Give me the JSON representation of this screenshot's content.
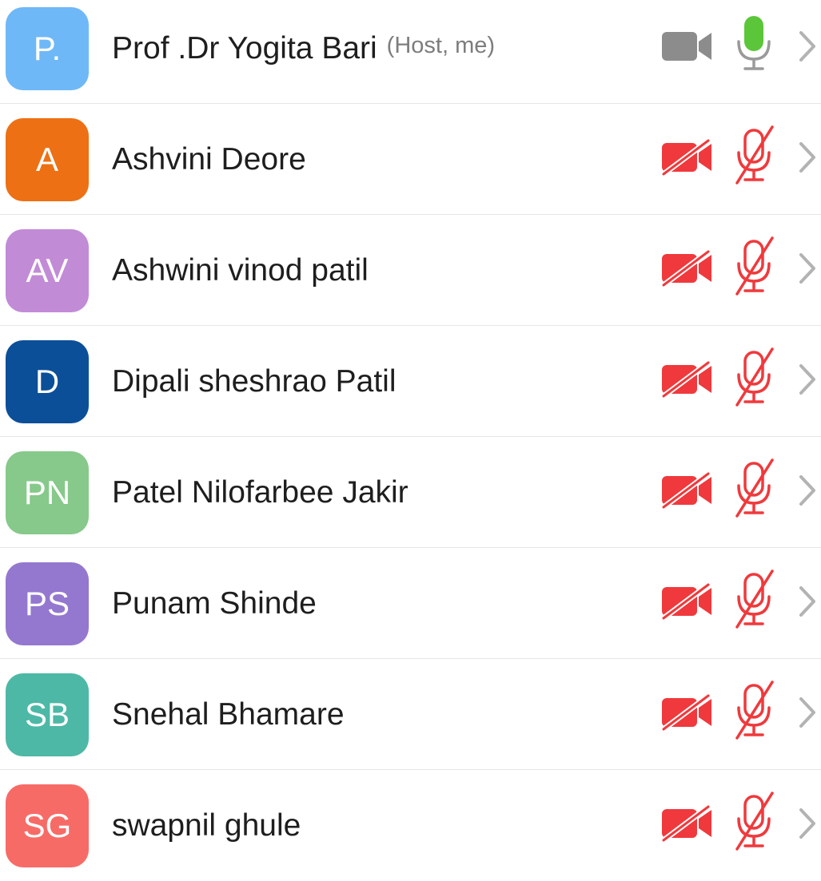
{
  "colors": {
    "video_on": "#8c8c8c",
    "mic_on": "#5cc63a",
    "muted": "#f0393c",
    "chevron": "#b3b3b3"
  },
  "participants": [
    {
      "initials": "P.",
      "name": "Prof .Dr Yogita Bari",
      "role": "(Host, me)",
      "avatar_color": "#6fb8f7",
      "video": "on",
      "mic": "on",
      "video_icon": "video-camera-icon",
      "mic_icon": "microphone-icon"
    },
    {
      "initials": "A",
      "name": "Ashvini Deore",
      "avatar_color": "#ed7014",
      "video": "off",
      "mic": "off",
      "video_icon": "video-camera-off-icon",
      "mic_icon": "microphone-muted-icon"
    },
    {
      "initials": "AV",
      "name": "Ashwini vinod patil",
      "avatar_color": "#c28bd6",
      "video": "off",
      "mic": "off",
      "video_icon": "video-camera-off-icon",
      "mic_icon": "microphone-muted-icon"
    },
    {
      "initials": "D",
      "name": "Dipali sheshrao Patil",
      "avatar_color": "#0c4f99",
      "video": "off",
      "mic": "off",
      "video_icon": "video-camera-off-icon",
      "mic_icon": "microphone-muted-icon"
    },
    {
      "initials": "PN",
      "name": "Patel Nilofarbee Jakir",
      "avatar_color": "#86c98a",
      "video": "off",
      "mic": "off",
      "video_icon": "video-camera-off-icon",
      "mic_icon": "microphone-muted-icon"
    },
    {
      "initials": "PS",
      "name": "Punam Shinde",
      "avatar_color": "#9478cf",
      "video": "off",
      "mic": "off",
      "video_icon": "video-camera-off-icon",
      "mic_icon": "microphone-muted-icon"
    },
    {
      "initials": "SB",
      "name": "Snehal Bhamare",
      "avatar_color": "#4db8a6",
      "video": "off",
      "mic": "off",
      "video_icon": "video-camera-off-icon",
      "mic_icon": "microphone-muted-icon"
    },
    {
      "initials": "SG",
      "name": "swapnil ghule",
      "avatar_color": "#f76b67",
      "video": "off",
      "mic": "off",
      "video_icon": "video-camera-off-icon",
      "mic_icon": "microphone-muted-icon"
    }
  ]
}
